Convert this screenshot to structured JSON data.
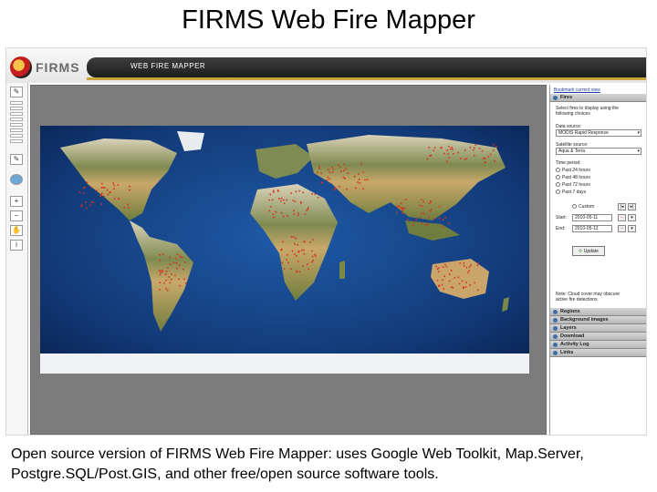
{
  "slide": {
    "title": "FIRMS Web Fire Mapper",
    "caption": "Open source version of FIRMS Web Fire Mapper: uses Google Web Toolkit, Map.Server, Postgre.SQL/Post.GIS, and other free/open source software tools."
  },
  "app": {
    "logo": "FIRMS",
    "banner": "WEB FIRE MAPPER",
    "accent_color": "#c9a43b",
    "banner_color": "#2a2a2a"
  },
  "panel": {
    "bookmark": "Bookmark current view",
    "fires_header": "Fires",
    "intro": [
      "Select fires to display using the",
      "following choices"
    ],
    "data_source_label": "Data source:",
    "data_source_value": "MODIS Rapid Response",
    "satellite_label": "Satellite source:",
    "satellite_value": "Aqua & Terra",
    "time_label": "Time period:",
    "time_options": [
      "Past 24 hours",
      "Past 48 hours",
      "Past 72 hours",
      "Past 7 days"
    ],
    "custom_label": "Custom",
    "start_label": "Start:",
    "start_value": "2010-05-11",
    "end_label": "End:",
    "end_value": "2010-05-12",
    "update_label": "Update",
    "note": [
      "Note: Cloud cover may obscure",
      "active fire detections"
    ],
    "sections": [
      "Regions",
      "Background images",
      "Layers",
      "Download",
      "Activity Log",
      "Links"
    ]
  },
  "toolbar": {
    "icons": [
      "pan-icon",
      "zoom-slider",
      "identify-icon",
      "globe-icon",
      "zoom-in-icon",
      "zoom-out-icon",
      "hand-icon",
      "info-icon"
    ]
  },
  "map": {
    "ocean_color": "#123a78",
    "fire_color": "#d8321e"
  }
}
